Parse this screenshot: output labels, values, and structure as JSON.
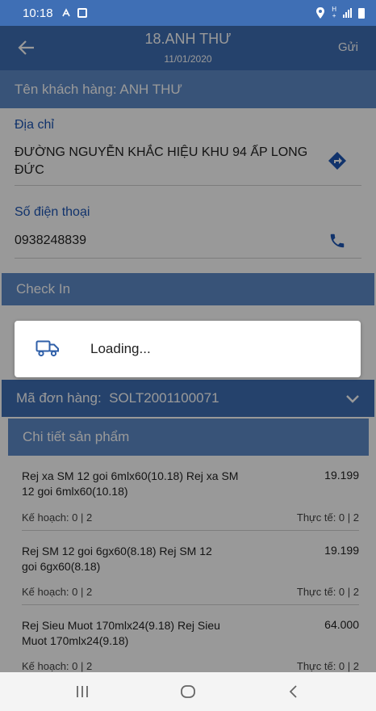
{
  "status_bar": {
    "time": "10:18",
    "network": "H\n+"
  },
  "header": {
    "title": "18.ANH THƯ",
    "date": "11/01/2020",
    "send_label": "Gửi"
  },
  "customer": {
    "label": "Tên khách hàng: ANH THƯ"
  },
  "address": {
    "label": "Địa chỉ",
    "value": "ĐƯỜNG NGUYỄN KHẮC HIỆU KHU 94 ẤP LONG ĐỨC"
  },
  "phone": {
    "label": "Số điện thoại",
    "value": "0938248839"
  },
  "checkin": {
    "label": "Check In"
  },
  "loading": {
    "text": "Loading..."
  },
  "order": {
    "label": "Mã đơn hàng:  SOLT2001100071"
  },
  "details": {
    "label": "Chi tiết sản phẩm"
  },
  "products": [
    {
      "name": "Rej xa SM 12 goi 6mlx60(10.18) Rej xa SM 12 goi 6mlx60(10.18)",
      "price": "19.199",
      "plan": "Kế hoạch: 0 | 2",
      "actual": "Thực tế: 0 | 2"
    },
    {
      "name": "Rej SM 12 goi 6gx60(8.18) Rej SM 12 goi 6gx60(8.18)",
      "price": "19.199",
      "plan": "Kế hoạch: 0 | 2",
      "actual": "Thực tế: 0 | 2"
    },
    {
      "name": "Rej Sieu Muot 170mlx24(9.18) Rej Sieu Muot 170mlx24(9.18)",
      "price": "64.000",
      "plan": "Kế hoạch: 0 | 2",
      "actual": "Thực tế: 0 | 2"
    }
  ],
  "colors": {
    "primary": "#3f6fb5",
    "secondary": "#5e8ac9",
    "label_blue": "#1d55b4"
  },
  "icons": {
    "back": "arrow-left-icon",
    "directions": "directions-icon",
    "phone": "phone-icon",
    "truck": "truck-icon",
    "chevron": "chevron-down-icon"
  }
}
